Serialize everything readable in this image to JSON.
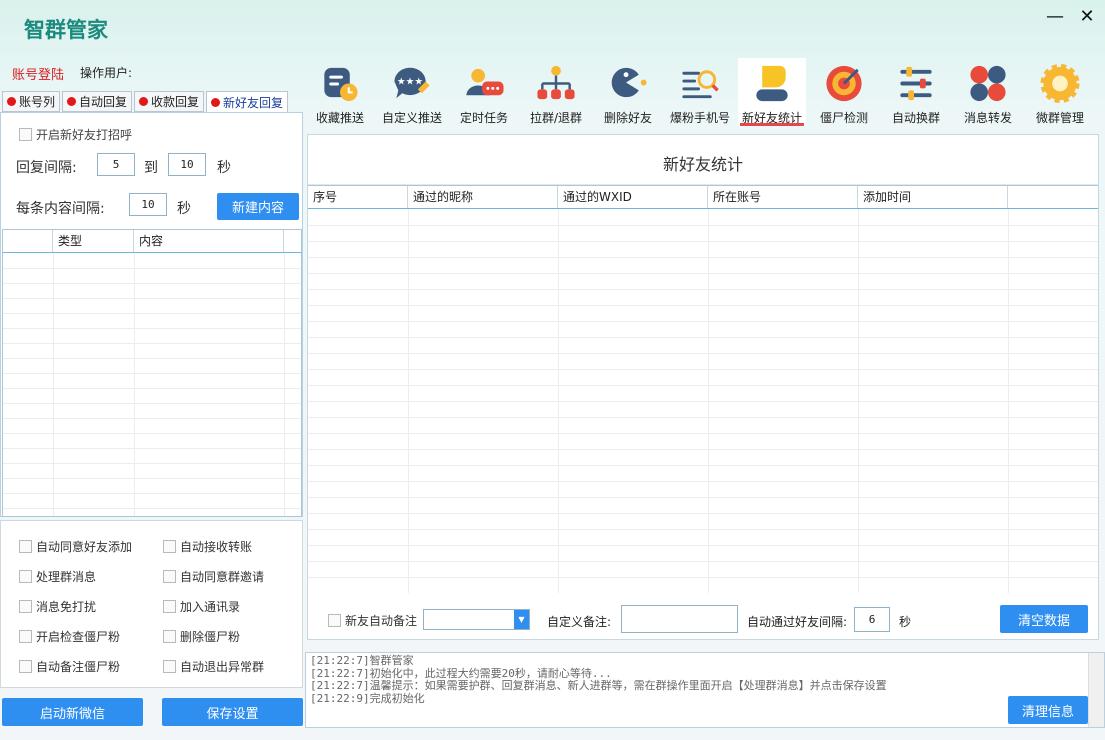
{
  "app": {
    "title": "智群管家",
    "minimize": "—",
    "close": "✕"
  },
  "account": {
    "login": "账号登陆",
    "operator_label": "操作用户:"
  },
  "left_tabs": [
    {
      "label": "账号列"
    },
    {
      "label": "自动回复"
    },
    {
      "label": "收款回复"
    },
    {
      "label": "新好友回复",
      "active": true
    }
  ],
  "greet": {
    "enable_label": "开启新好友打招呼",
    "reply_interval_label": "回复间隔:",
    "interval_from": "5",
    "to_label": "到",
    "interval_to": "10",
    "seconds": "秒",
    "each_interval_label": "每条内容间隔:",
    "each_interval": "10",
    "new_content_button": "新建内容",
    "columns": [
      "类型",
      "内容"
    ]
  },
  "options": [
    [
      "自动同意好友添加",
      "自动接收转账"
    ],
    [
      "处理群消息",
      "自动同意群邀请"
    ],
    [
      "消息免打扰",
      "加入通讯录"
    ],
    [
      "开启检查僵尸粉",
      "删除僵尸粉"
    ],
    [
      "自动备注僵尸粉",
      "自动退出异常群"
    ]
  ],
  "bottom_buttons": {
    "start_wechat": "启动新微信",
    "save_settings": "保存设置"
  },
  "toolbar": [
    {
      "label": "收藏推送",
      "icon": "favorite-push-icon"
    },
    {
      "label": "自定义推送",
      "icon": "custom-push-icon"
    },
    {
      "label": "定时任务",
      "icon": "scheduled-task-icon"
    },
    {
      "label": "拉群/退群",
      "icon": "group-pull-icon"
    },
    {
      "label": "删除好友",
      "icon": "delete-friend-icon"
    },
    {
      "label": "爆粉手机号",
      "icon": "phone-search-icon"
    },
    {
      "label": "新好友统计",
      "icon": "new-friend-stats-icon",
      "active": true
    },
    {
      "label": "僵尸检测",
      "icon": "zombie-detect-icon"
    },
    {
      "label": "自动换群",
      "icon": "auto-switch-group-icon"
    },
    {
      "label": "消息转发",
      "icon": "message-forward-icon"
    },
    {
      "label": "微群管理",
      "icon": "group-manage-icon"
    }
  ],
  "stats": {
    "title": "新好友统计",
    "columns": [
      "序号",
      "通过的昵称",
      "通过的WXID",
      "所在账号",
      "添加时间",
      ""
    ],
    "auto_remark_label": "新友自动备注",
    "custom_remark_label": "自定义备注:",
    "auto_pass_interval_label": "自动通过好友间隔:",
    "auto_pass_interval": "6",
    "seconds": "秒",
    "clear_button": "清空数据"
  },
  "log": {
    "lines": [
      "[21:22:7]智群管家",
      "[21:22:7]初始化中，此过程大约需要20秒，请耐心等待...",
      "[21:22:7]温馨提示：如果需要护群、回复群消息、新人进群等，需在群操作里面开启【处理群消息】并点击保存设置",
      "[21:22:9]完成初始化"
    ],
    "clear_button": "清理信息"
  }
}
